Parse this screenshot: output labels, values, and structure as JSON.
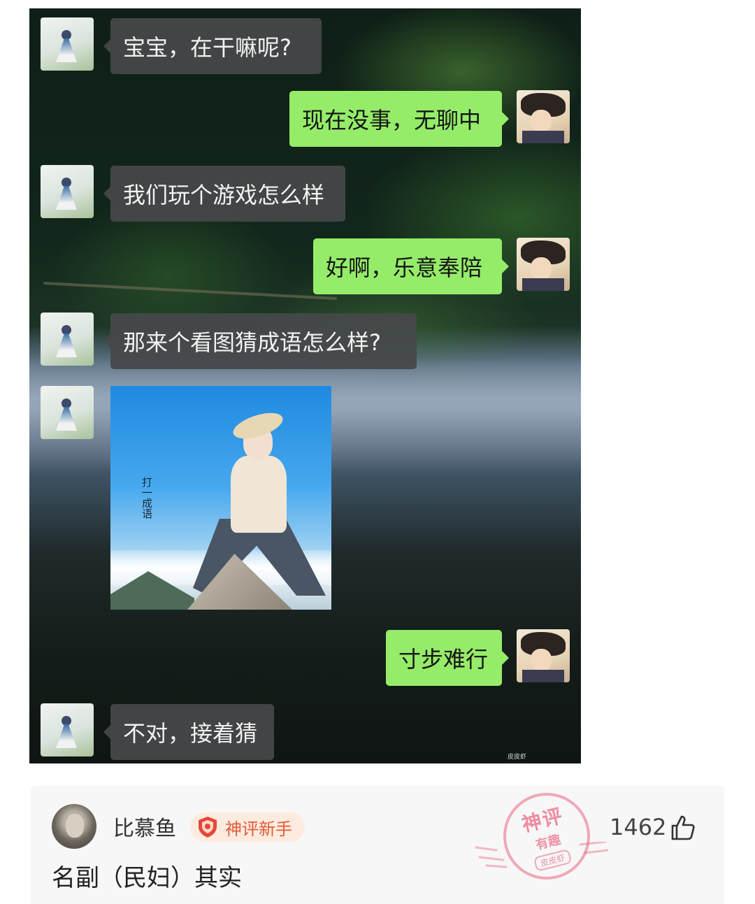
{
  "chat": {
    "messages": [
      {
        "side": "in",
        "text": "宝宝，在干嘛呢?"
      },
      {
        "side": "out",
        "text": "现在没事，无聊中"
      },
      {
        "side": "in",
        "text": "我们玩个游戏怎么样"
      },
      {
        "side": "out",
        "text": "好啊，乐意奉陪"
      },
      {
        "side": "in",
        "text": "那来个看图猜成语怎么样?"
      },
      {
        "side": "in",
        "type": "image",
        "caption": "打一成语"
      },
      {
        "side": "out",
        "text": "寸步难行"
      },
      {
        "side": "in",
        "text": "不对，接着猜"
      }
    ],
    "watermark": "皮皮虾"
  },
  "comment": {
    "username": "比慕鱼",
    "badge": "神评新手",
    "text": "名副（民妇）其实",
    "likes": "1462",
    "stamp": {
      "line1": "神评",
      "line2": "有趣",
      "line3": "皮皮虾"
    },
    "colors": {
      "badge_text": "#e25b3a",
      "stamp": "#ea6882"
    }
  },
  "icons": [
    "avatar-female",
    "avatar-male",
    "shield-badge-icon",
    "thumbs-up-icon"
  ]
}
